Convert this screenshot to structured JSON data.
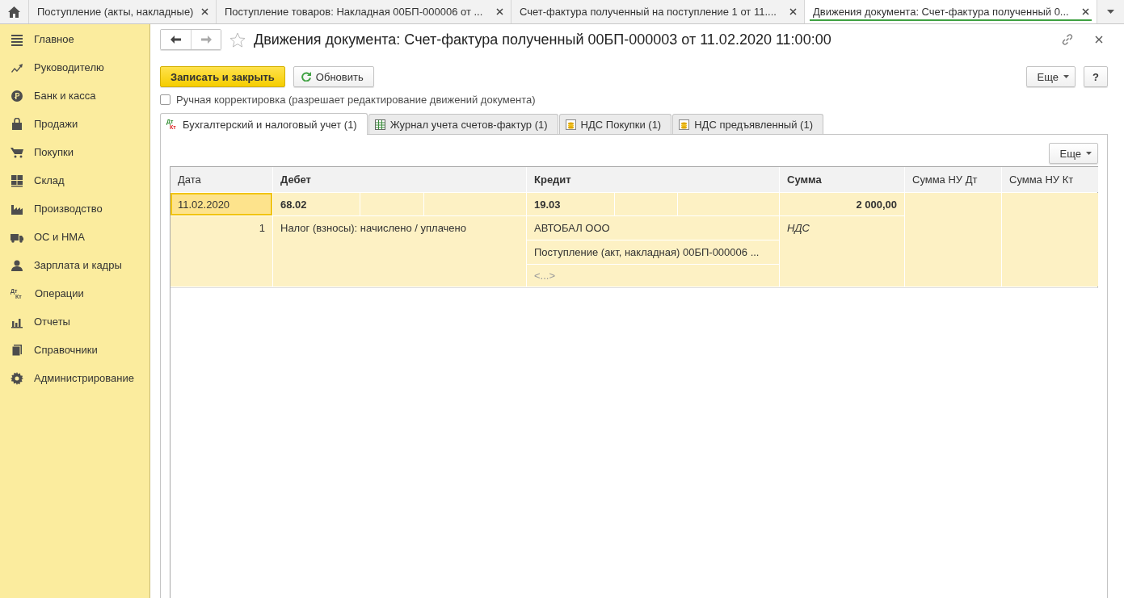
{
  "top_tabs": [
    {
      "label": "Поступление (акты, накладные)",
      "selected": false
    },
    {
      "label": "Поступление товаров: Накладная 00БП-000006 от ...",
      "selected": false
    },
    {
      "label": "Счет-фактура полученный на поступление 1 от 11....",
      "selected": false
    },
    {
      "label": "Движения документа: Счет-фактура полученный 0...",
      "selected": true
    }
  ],
  "sidebar": {
    "items": [
      {
        "label": "Главное",
        "kind": "lines"
      },
      {
        "label": "Руководителю",
        "kind": "trend"
      },
      {
        "label": "Банк и касса",
        "kind": "ruble"
      },
      {
        "label": "Продажи",
        "kind": "bag"
      },
      {
        "label": "Покупки",
        "kind": "cart"
      },
      {
        "label": "Склад",
        "kind": "grid"
      },
      {
        "label": "Производство",
        "kind": "factory"
      },
      {
        "label": "ОС и НМА",
        "kind": "truck"
      },
      {
        "label": "Зарплата и кадры",
        "kind": "person"
      },
      {
        "label": "Операции",
        "kind": "dtkt",
        "icon_text": [
          "Дт",
          "Кт"
        ]
      },
      {
        "label": "Отчеты",
        "kind": "bars"
      },
      {
        "label": "Справочники",
        "kind": "books"
      },
      {
        "label": "Администрирование",
        "kind": "gear"
      }
    ]
  },
  "form": {
    "title": "Движения документа: Счет-фактура полученный 00БП-000003 от 11.02.2020 11:00:00",
    "buttons": {
      "save": "Записать и закрыть",
      "refresh": "Обновить",
      "more": "Еще",
      "help": "?"
    },
    "manual_edit": {
      "label": "Ручная корректировка (разрешает редактирование движений документа)",
      "checked": false
    },
    "tabs": [
      {
        "label": "Бухгалтерский и налоговый учет (1)",
        "kind": "dtkt",
        "icon_text": [
          "Дт",
          "Кт"
        ],
        "selected": true
      },
      {
        "label": "Журнал учета счетов-фактур (1)",
        "kind": "journal",
        "selected": false
      },
      {
        "label": "НДС Покупки (1)",
        "kind": "coins",
        "selected": false
      },
      {
        "label": "НДС предъявленный (1)",
        "kind": "coins",
        "selected": false
      }
    ],
    "table_more": "Еще",
    "table": {
      "columns": [
        {
          "label": "Дата",
          "bold": false
        },
        {
          "label": "Дебет",
          "bold": true
        },
        {
          "label": "Кредит",
          "bold": true
        },
        {
          "label": "Сумма",
          "bold": true
        },
        {
          "label": "Сумма НУ Дт",
          "bold": false
        },
        {
          "label": "Сумма НУ Кт",
          "bold": false
        }
      ],
      "rows": [
        {
          "date": "11.02.2020",
          "date_selected": true,
          "line": "1",
          "debit_account": "68.02",
          "debit_content": "Налог (взносы): начислено / уплачено",
          "credit_account": "19.03",
          "credit_subconto": [
            {
              "text": "АВТОБАЛ ООО",
              "kind": "value"
            },
            {
              "text": "Поступление (акт, накладная) 00БП-000006 ...",
              "kind": "value"
            },
            {
              "text": "<...>",
              "kind": "empty"
            }
          ],
          "amount": "2 000,00",
          "amount_content": "НДС"
        }
      ]
    }
  }
}
